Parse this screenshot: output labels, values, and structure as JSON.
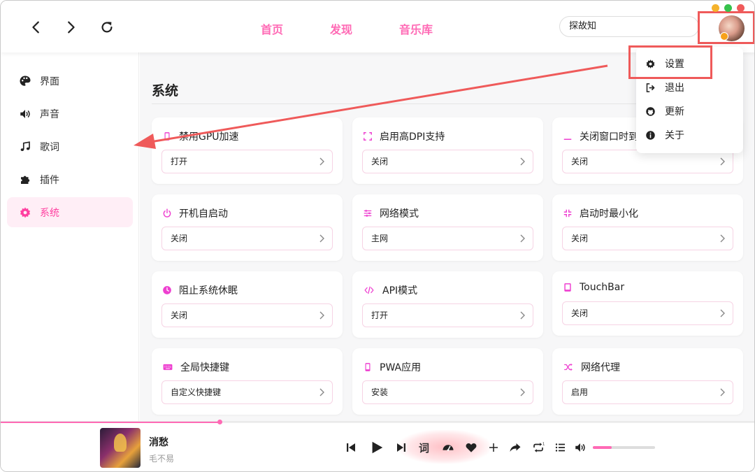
{
  "header": {
    "tabs": [
      {
        "label": "首页"
      },
      {
        "label": "发现"
      },
      {
        "label": "音乐库"
      }
    ],
    "search": {
      "value": "探故知"
    },
    "window_controls": {
      "colors": [
        "#f5b32c",
        "#36c24c",
        "#f05a5a"
      ]
    }
  },
  "menu": {
    "items": [
      {
        "label": "设置",
        "icon": "gear-icon"
      },
      {
        "label": "退出",
        "icon": "sign-out-icon"
      },
      {
        "label": "更新",
        "icon": "github-icon"
      },
      {
        "label": "关于",
        "icon": "info-icon"
      }
    ]
  },
  "sidebar": {
    "items": [
      {
        "label": "界面",
        "icon": "palette-icon"
      },
      {
        "label": "声音",
        "icon": "volume-icon"
      },
      {
        "label": "歌词",
        "icon": "music-note-icon"
      },
      {
        "label": "插件",
        "icon": "puzzle-icon"
      },
      {
        "label": "系统",
        "icon": "gear-icon",
        "active": true
      }
    ]
  },
  "main": {
    "section_title": "系统",
    "cards": [
      {
        "title": "禁用GPU加速",
        "value": "打开",
        "icon": "mobile-icon"
      },
      {
        "title": "启用高DPI支持",
        "value": "关闭",
        "icon": "expand-icon"
      },
      {
        "title": "关闭窗口时到",
        "value": "关闭",
        "icon": "minimize-icon"
      },
      {
        "title": "开机自启动",
        "value": "关闭",
        "icon": "power-icon"
      },
      {
        "title": "网络模式",
        "value": "主网",
        "icon": "sliders-icon"
      },
      {
        "title": "启动时最小化",
        "value": "关闭",
        "icon": "compress-icon"
      },
      {
        "title": "阻止系统休眠",
        "value": "关闭",
        "icon": "clock-icon"
      },
      {
        "title": "API模式",
        "value": "打开",
        "icon": "code-icon"
      },
      {
        "title": "TouchBar",
        "value": "关闭",
        "icon": "tablet-icon"
      },
      {
        "title": "全局快捷键",
        "value": "自定义快捷键",
        "icon": "keyboard-icon"
      },
      {
        "title": "PWA应用",
        "value": "安装",
        "icon": "mobile-icon"
      },
      {
        "title": "网络代理",
        "value": "启用",
        "icon": "shuffle-icon"
      }
    ]
  },
  "player": {
    "song_title": "消愁",
    "artist": "毛不易",
    "lyric_label": "词",
    "progress": 0.29,
    "volume": 0.3,
    "accent": "#ff6ab5"
  }
}
